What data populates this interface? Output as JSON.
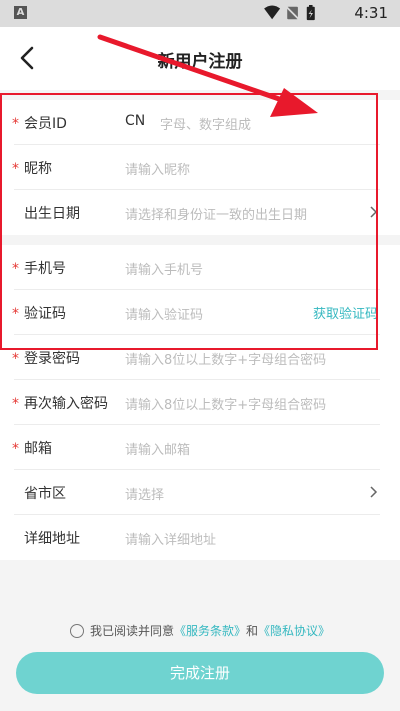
{
  "status_bar": {
    "app_icon_letter": "A",
    "time": "4:31"
  },
  "header": {
    "title": "新用户注册",
    "back_icon": "chevron-left-icon"
  },
  "form": {
    "member_id": {
      "label": "会员ID",
      "prefix": "CN",
      "placeholder": "字母、数字组成",
      "required": true
    },
    "nickname": {
      "label": "昵称",
      "placeholder": "请输入昵称",
      "required": true
    },
    "birthdate": {
      "label": "出生日期",
      "placeholder": "请选择和身份证一致的出生日期",
      "required": false
    },
    "phone": {
      "label": "手机号",
      "placeholder": "请输入手机号",
      "required": true
    },
    "verify_code": {
      "label": "验证码",
      "placeholder": "请输入验证码",
      "action": "获取验证码",
      "required": true
    },
    "password": {
      "label": "登录密码",
      "placeholder": "请输入8位以上数字+字母组合密码",
      "required": true
    },
    "password_confirm": {
      "label": "再次输入密码",
      "placeholder": "请输入8位以上数字+字母组合密码",
      "required": true
    },
    "email": {
      "label": "邮箱",
      "placeholder": "请输入邮箱",
      "required": true
    },
    "region": {
      "label": "省市区",
      "placeholder": "请选择",
      "required": false
    },
    "address": {
      "label": "详细地址",
      "placeholder": "请输入详细地址",
      "required": false
    }
  },
  "agreement": {
    "prefix": "我已阅读并同意",
    "terms": "《服务条款》",
    "and": "和",
    "privacy": "《隐私协议》"
  },
  "submit_label": "完成注册",
  "colors": {
    "accent": "#35b8c0",
    "button": "#6fd3d0",
    "required_star": "#e53935",
    "annotation": "#e8192c"
  }
}
